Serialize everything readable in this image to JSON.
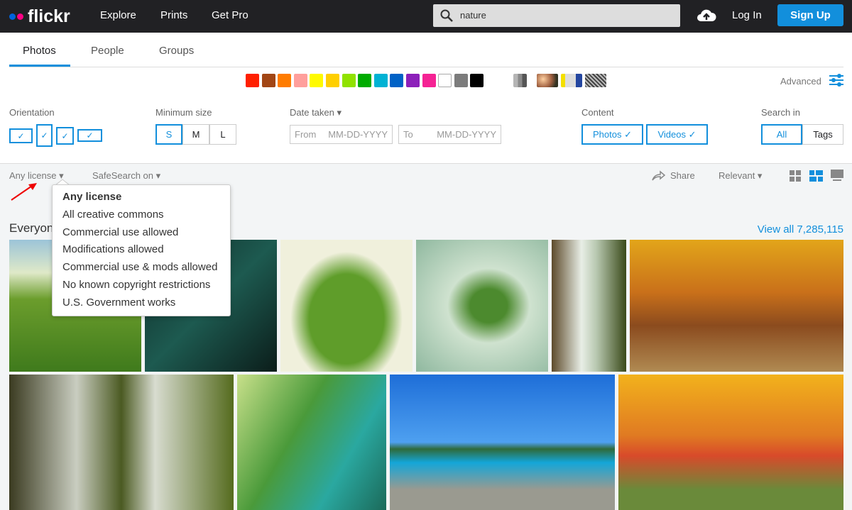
{
  "header": {
    "logo": "flickr",
    "nav": [
      "Explore",
      "Prints",
      "Get Pro"
    ],
    "search_value": "nature",
    "login": "Log In",
    "signup": "Sign Up"
  },
  "tabs": [
    {
      "label": "Photos",
      "active": true
    },
    {
      "label": "People"
    },
    {
      "label": "Groups"
    }
  ],
  "colors": [
    "#ff2000",
    "#a24615",
    "#ff7c00",
    "#ff9f9c",
    "#fffa00",
    "#ffcf00",
    "#90e200",
    "#00ab00",
    "#00b2d4",
    "#0062c6",
    "#8c20ba",
    "#f52394",
    "#ffffff",
    "#7c7c7c",
    "#000000"
  ],
  "advanced": "Advanced",
  "filters": {
    "orientation": {
      "label": "Orientation"
    },
    "size": {
      "label": "Minimum size",
      "options": [
        "S",
        "M",
        "L"
      ],
      "selected": "S"
    },
    "date": {
      "label": "Date taken",
      "from_label": "From",
      "to_label": "To",
      "placeholder": "MM-DD-YYYY"
    },
    "content": {
      "label": "Content",
      "options": [
        "Photos",
        "Videos"
      ]
    },
    "search_in": {
      "label": "Search in",
      "options": [
        "All",
        "Tags"
      ],
      "selected": "All"
    }
  },
  "toolbar": {
    "license": "Any license",
    "safesearch": "SafeSearch on",
    "share": "Share",
    "sort": "Relevant"
  },
  "license_menu": [
    "Any license",
    "All creative commons",
    "Commercial use allowed",
    "Modifications allowed",
    "Commercial use & mods allowed",
    "No known copyright restrictions",
    "U.S. Government works"
  ],
  "section_title": "Everyone's photos",
  "view_all": "View all 7,285,115",
  "accent": "#128fdc"
}
